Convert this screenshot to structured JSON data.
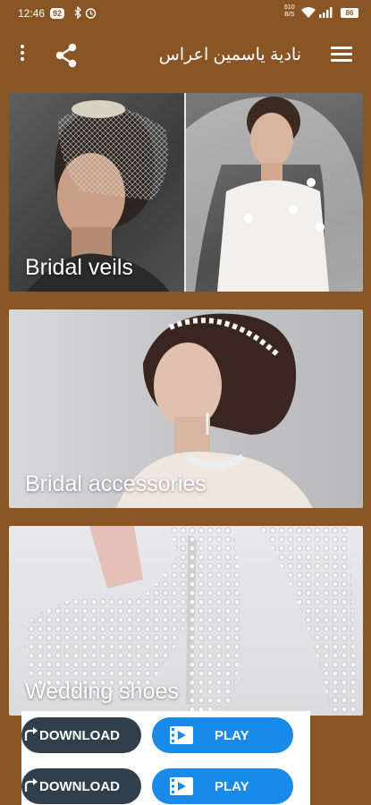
{
  "status_bar": {
    "time": "12:46",
    "badge": "92",
    "speed_value": "610",
    "speed_unit": "B/S",
    "battery": "86"
  },
  "app_bar": {
    "title": "نادية ياسمين اعراس",
    "icons": [
      "more-vert-icon",
      "share-icon",
      "hamburger-menu-icon"
    ]
  },
  "categories": [
    {
      "label": "Bridal veils"
    },
    {
      "label": "Bridal accessories"
    },
    {
      "label": "Wedding shoes"
    }
  ],
  "ads": {
    "download_label": "DOWNLOAD",
    "play_label": "PLAY"
  },
  "colors": {
    "brand_brown": "#8a5525",
    "download_button": "#2f3f4c",
    "play_button": "#1a8ae8"
  }
}
